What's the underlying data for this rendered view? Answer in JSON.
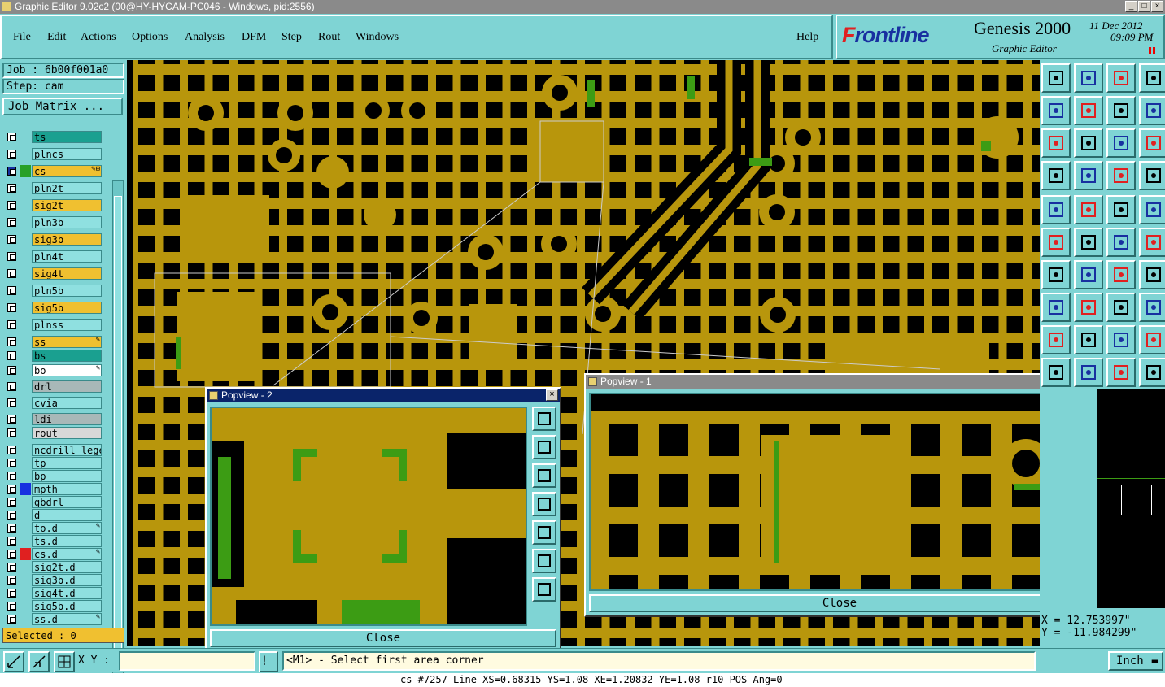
{
  "window": {
    "title": "Graphic Editor 9.02c2 (00@HY-HYCAM-PC046 - Windows, pid:2556)"
  },
  "menu": {
    "items": [
      "File",
      "Edit",
      "Actions",
      "Options",
      "Analysis",
      "DFM",
      "Step",
      "Rout",
      "Windows"
    ],
    "help": "Help"
  },
  "brand": {
    "logo_f": "F",
    "logo_rest": "rontline",
    "product": "Genesis 2000",
    "subtitle": "Graphic Editor",
    "date": "11 Dec 2012",
    "time": "09:09 PM"
  },
  "job": {
    "job_label": "Job : 6b00f001a0",
    "step_label": "Step: cam",
    "matrix_button": "Job Matrix ..."
  },
  "layers": [
    {
      "name": "ts",
      "color": "#1aa090",
      "tag": ""
    },
    {
      "name": "plncs",
      "color": "#8fe0e0",
      "tag": ""
    },
    {
      "name": "cs",
      "color": "#f0c030",
      "tag": "✎⊞",
      "swatch": "#28a028",
      "work": true
    },
    {
      "name": "pln2t",
      "color": "#8fe0e0",
      "tag": ""
    },
    {
      "name": "sig2t",
      "color": "#f0c030",
      "tag": ""
    },
    {
      "name": "pln3b",
      "color": "#8fe0e0",
      "tag": ""
    },
    {
      "name": "sig3b",
      "color": "#f0c030",
      "tag": ""
    },
    {
      "name": "pln4t",
      "color": "#8fe0e0",
      "tag": ""
    },
    {
      "name": "sig4t",
      "color": "#f0c030",
      "tag": ""
    },
    {
      "name": "pln5b",
      "color": "#8fe0e0",
      "tag": ""
    },
    {
      "name": "sig5b",
      "color": "#f0c030",
      "tag": ""
    },
    {
      "name": "plnss",
      "color": "#8fe0e0",
      "tag": ""
    },
    {
      "name": "ss",
      "color": "#f0c030",
      "tag": "✎"
    },
    {
      "name": "bs",
      "color": "#1aa090",
      "tag": ""
    },
    {
      "name": "bo",
      "color": "#ffffff",
      "tag": "✎"
    },
    {
      "name": "drl",
      "color": "#a8b8b8",
      "tag": ""
    },
    {
      "name": "cvia",
      "color": "#8fe0e0",
      "tag": ""
    },
    {
      "name": "ldi",
      "color": "#a8b8b8",
      "tag": ""
    },
    {
      "name": "rout",
      "color": "#d8d8d8",
      "tag": ""
    },
    {
      "name": "ncdrill_lege",
      "color": "#8fe0e0",
      "tag": ""
    },
    {
      "name": "tp",
      "color": "#8fe0e0",
      "tag": ""
    },
    {
      "name": "bp",
      "color": "#8fe0e0",
      "tag": ""
    },
    {
      "name": "mpth",
      "color": "#8fe0e0",
      "tag": "",
      "swatch": "#1830e0"
    },
    {
      "name": "gbdrl",
      "color": "#8fe0e0",
      "tag": ""
    },
    {
      "name": "d",
      "color": "#8fe0e0",
      "tag": ""
    },
    {
      "name": "to.d",
      "color": "#8fe0e0",
      "tag": "✎"
    },
    {
      "name": "ts.d",
      "color": "#8fe0e0",
      "tag": ""
    },
    {
      "name": "cs.d",
      "color": "#8fe0e0",
      "tag": "✎",
      "swatch": "#e02020"
    },
    {
      "name": "sig2t.d",
      "color": "#8fe0e0",
      "tag": ""
    },
    {
      "name": "sig3b.d",
      "color": "#8fe0e0",
      "tag": ""
    },
    {
      "name": "sig4t.d",
      "color": "#8fe0e0",
      "tag": ""
    },
    {
      "name": "sig5b.d",
      "color": "#8fe0e0",
      "tag": ""
    },
    {
      "name": "ss.d",
      "color": "#8fe0e0",
      "tag": "✎"
    }
  ],
  "selected": "Selected : 0",
  "popview2": {
    "title": "Popview - 2",
    "close": "Close"
  },
  "popview1": {
    "title": "Popview - 1",
    "close": "Close"
  },
  "coords": {
    "x": "X = 12.753997\"",
    "y": "Y = -11.984299\""
  },
  "status": {
    "xy_label": "X Y :",
    "xy_value": "",
    "message": "<M1> - Select first area corner",
    "unit": "Inch",
    "warn": "!"
  },
  "bottom_line": "cs #7257 Line XS=0.68315 YS=1.08 XE=1.20832 YE=1.08 r10 POS Ang=0",
  "colors": {
    "copper": "#b8960c",
    "green": "#3c9c14",
    "panel": "#7fd4d4"
  }
}
